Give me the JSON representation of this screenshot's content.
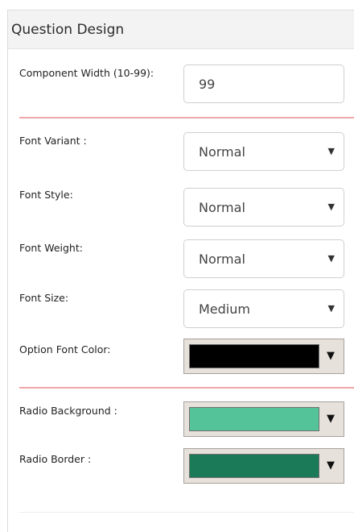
{
  "panel": {
    "title": "Question Design"
  },
  "width_field": {
    "label": "Component Width (10-99):",
    "value": "99"
  },
  "font_variant": {
    "label": "Font Variant :",
    "selected": "Normal"
  },
  "font_style": {
    "label": "Font Style:",
    "selected": "Normal"
  },
  "font_weight": {
    "label": "Font Weight:",
    "selected": "Normal"
  },
  "font_size": {
    "label": "Font Size:",
    "selected": "Medium"
  },
  "option_font_color": {
    "label": "Option Font Color:",
    "color": "#000000"
  },
  "radio_background": {
    "label": "Radio Background :",
    "color": "#55c39a"
  },
  "radio_border": {
    "label": "Radio Border :",
    "color": "#1b7a57"
  },
  "icons": {
    "dropdown_arrow": "▼"
  },
  "colors": {
    "separator": "#f0a7a7",
    "header_bg": "#f3f3f3"
  }
}
